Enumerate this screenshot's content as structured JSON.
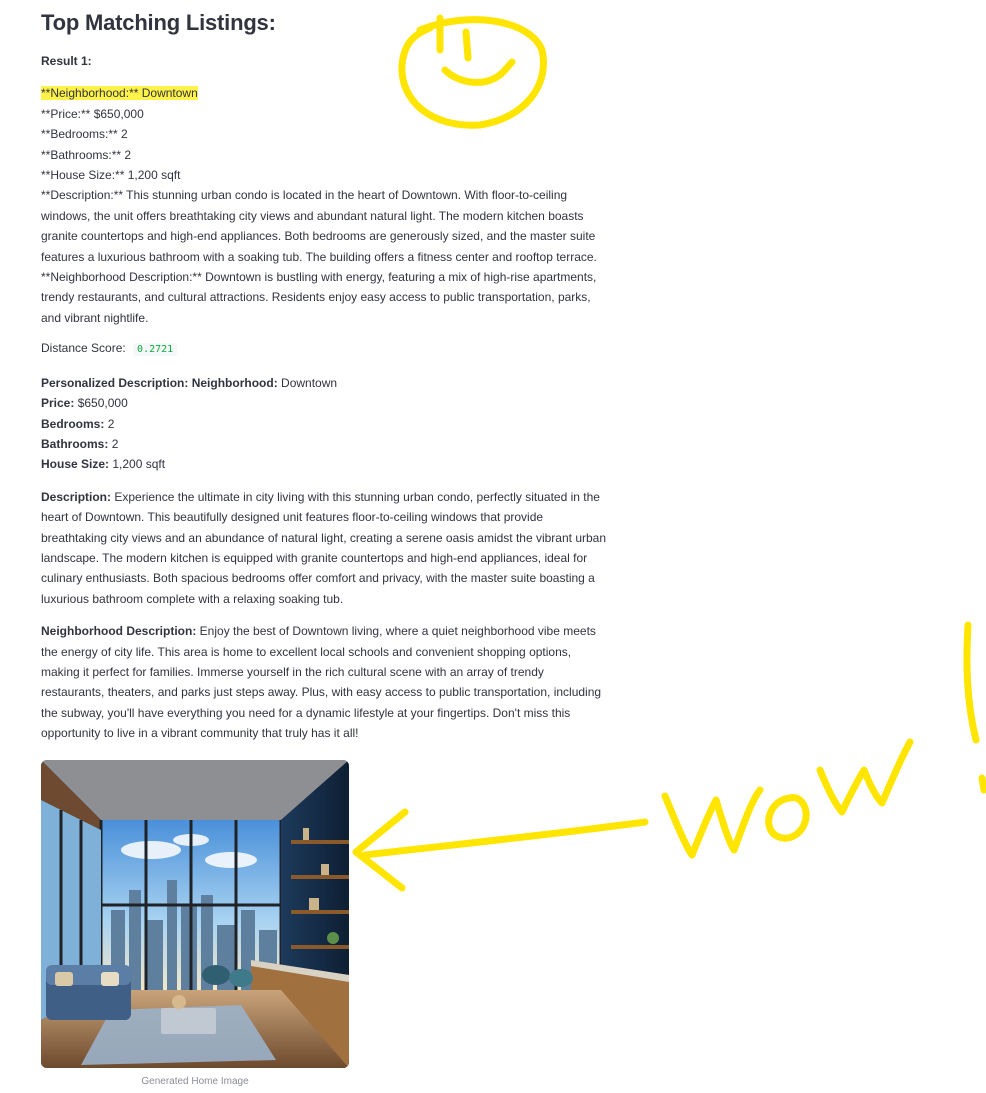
{
  "page": {
    "title": "Top Matching Listings:"
  },
  "result": {
    "label": "Result 1:",
    "raw": {
      "neighborhood": "**Neighborhood:** Downtown",
      "price": "**Price:** $650,000",
      "bedrooms": "**Bedrooms:** 2",
      "bathrooms": "**Bathrooms:** 2",
      "house_size": "**House Size:** 1,200 sqft",
      "description": "**Description:** This stunning urban condo is located in the heart of Downtown. With floor-to-ceiling windows, the unit offers breathtaking city views and abundant natural light. The modern kitchen boasts granite countertops and high-end appliances. Both bedrooms are generously sized, and the master suite features a luxurious bathroom with a soaking tub. The building offers a fitness center and rooftop terrace.",
      "neighborhood_description": "**Neighborhood Description:** Downtown is bustling with energy, featuring a mix of high-rise apartments, trendy restaurants, and cultural attractions. Residents enjoy easy access to public transportation, parks, and vibrant nightlife."
    },
    "distance": {
      "label": "Distance Score:",
      "value": "0.2721"
    },
    "personalized": {
      "heading": "Personalized Description:",
      "neighborhood_label": "Neighborhood:",
      "neighborhood_value": "Downtown",
      "price_label": "Price:",
      "price_value": "$650,000",
      "bedrooms_label": "Bedrooms:",
      "bedrooms_value": "2",
      "bathrooms_label": "Bathrooms:",
      "bathrooms_value": "2",
      "house_size_label": "House Size:",
      "house_size_value": "1,200 sqft",
      "description_label": "Description:",
      "description_text": "Experience the ultimate in city living with this stunning urban condo, perfectly situated in the heart of Downtown. This beautifully designed unit features floor-to-ceiling windows that provide breathtaking city views and an abundance of natural light, creating a serene oasis amidst the vibrant urban landscape. The modern kitchen is equipped with granite countertops and high-end appliances, ideal for culinary enthusiasts. Both spacious bedrooms offer comfort and privacy, with the master suite boasting a luxurious bathroom complete with a relaxing soaking tub.",
      "neighborhood_desc_label": "Neighborhood Description:",
      "neighborhood_desc_text": "Enjoy the best of Downtown living, where a quiet neighborhood vibe meets the energy of city life. This area is home to excellent local schools and convenient shopping options, making it perfect for families. Immerse yourself in the rich cultural scene with an array of trendy restaurants, theaters, and parks just steps away. Plus, with easy access to public transportation, including the subway, you'll have everything you need for a dynamic lifestyle at your fingertips. Don't miss this opportunity to live in a vibrant community that truly has it all!"
    },
    "image": {
      "caption": "Generated Home Image"
    }
  },
  "annotations": {
    "text": "wow",
    "color": "#ffe500"
  }
}
